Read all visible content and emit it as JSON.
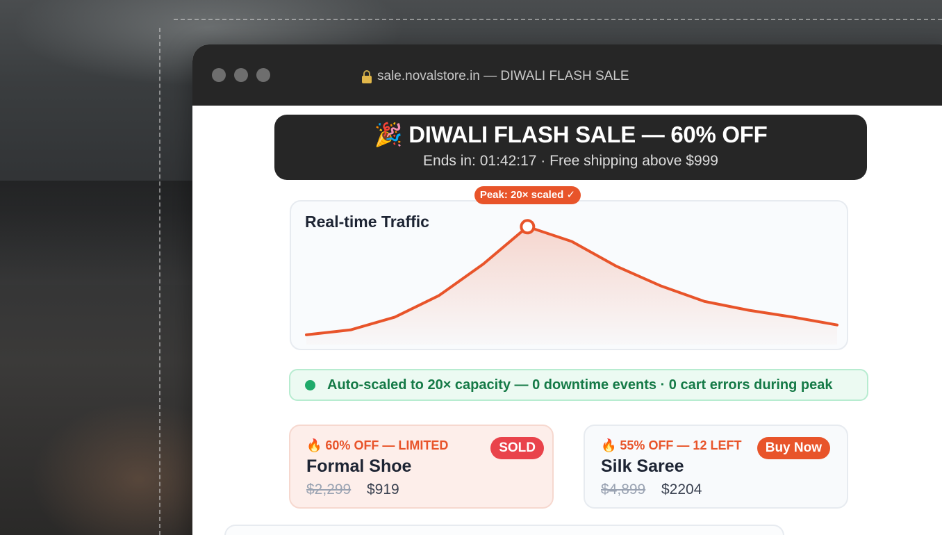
{
  "browser": {
    "url_text": "sale.novalstore.in — DIWALI FLASH SALE"
  },
  "banner": {
    "title": "🎉 DIWALI FLASH SALE — 60% OFF",
    "subtitle": "Ends in: 01:42:17 · Free shipping above $999"
  },
  "chart_data": {
    "type": "line",
    "title": "Real-time Traffic",
    "x": [
      0,
      1,
      2,
      3,
      4,
      5,
      6,
      7,
      8,
      9,
      10,
      11,
      12
    ],
    "values": [
      1.0,
      1.5,
      2.8,
      5.0,
      8.2,
      12.0,
      10.5,
      8.0,
      6.0,
      4.4,
      3.5,
      2.8,
      2.0
    ],
    "ylim": [
      0,
      14
    ],
    "annotations": [
      {
        "x": 5,
        "label": "Peak: 20× scaled ✓"
      }
    ],
    "grid": false,
    "color": "#e8542a"
  },
  "status": {
    "text": "Auto-scaled to 20× capacity — 0 downtime events · 0 cart errors during peak",
    "color": "#1faa6a"
  },
  "products": [
    {
      "tag": "🔥 60% OFF — LIMITED",
      "name": "Formal Shoe",
      "old_price": "$2,299",
      "new_price": "$919",
      "button": "SOLD"
    },
    {
      "tag": "🔥 55% OFF — 12 LEFT",
      "name": "Silk Saree",
      "old_price": "$4,899",
      "new_price": "$2204",
      "button": "Buy Now"
    }
  ]
}
